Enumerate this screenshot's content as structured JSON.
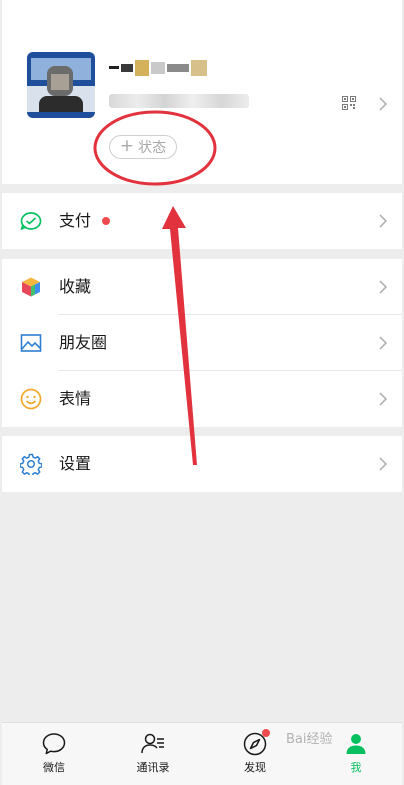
{
  "profile": {
    "status_plus": "+",
    "status_label": "状态"
  },
  "menu": {
    "pay": {
      "label": "支付",
      "icon": "wallet-icon",
      "has_badge": true
    },
    "favorites": {
      "label": "收藏",
      "icon": "cube-icon"
    },
    "moments": {
      "label": "朋友圈",
      "icon": "image-icon"
    },
    "stickers": {
      "label": "表情",
      "icon": "smiley-icon"
    },
    "settings": {
      "label": "设置",
      "icon": "gear-icon"
    }
  },
  "tabbar": {
    "tabs": [
      {
        "label": "微信",
        "icon": "chat-bubble-icon",
        "active": false
      },
      {
        "label": "通讯录",
        "icon": "contacts-icon",
        "active": false
      },
      {
        "label": "发现",
        "icon": "compass-icon",
        "active": false,
        "badge": true
      },
      {
        "label": "我",
        "icon": "person-icon",
        "active": true
      }
    ]
  },
  "watermark": "Bai经验",
  "colors": {
    "accent": "#07c160",
    "badge": "#f0494e",
    "annotation": "#e2323d",
    "background": "#ededed"
  }
}
